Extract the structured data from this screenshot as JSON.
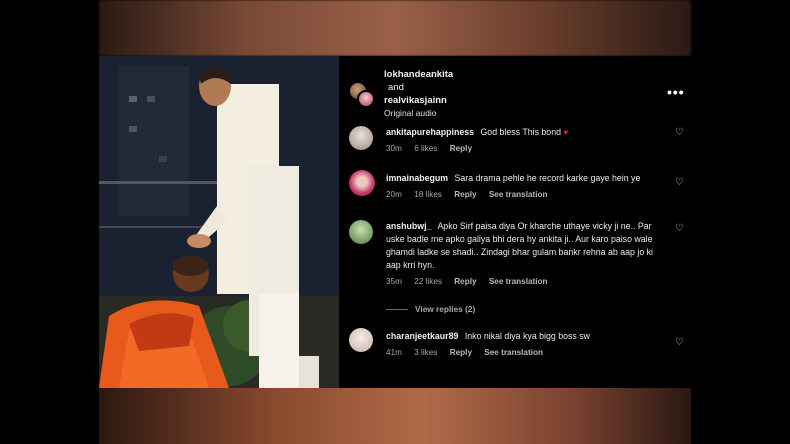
{
  "header": {
    "user1": "lokhandeankita",
    "conjunction": "and",
    "user2": "realvikasjainn",
    "audio": "Original audio",
    "more_icon": "more-horizontal-icon"
  },
  "comments": [
    {
      "username": "ankitapurehappiness",
      "text": "God bless This bond",
      "time": "30m",
      "likes": "6 likes",
      "reply": "Reply",
      "translation": "",
      "avatar_color": "#9a8a80"
    },
    {
      "username": "imnainabegum",
      "text": "Sara drama pehle he record karke gaye hein ye",
      "time": "20m",
      "likes": "18 likes",
      "reply": "Reply",
      "translation": "See translation",
      "avatar_color": "#c03a6a"
    },
    {
      "username": "anshubwj_",
      "text": "Apko Sirf paisa diya Or kharche uthaye vicky ji ne.. Par uske badle me apko galiya bhi dera hy ankita ji.. Aur karo paiso wale ghamdi ladke se shadi.. Zindagi bhar gulam bankr rehna ab aap jo ki aap krri hyn.",
      "time": "35m",
      "likes": "22 likes",
      "reply": "Reply",
      "translation": "See translation",
      "view_replies": "View replies (2)",
      "avatar_color": "#6a8a4a"
    },
    {
      "username": "charanjeetkaur89",
      "text": "Inko nikal diya kya bigg boss sw",
      "time": "41m",
      "likes": "3 likes",
      "reply": "Reply",
      "translation": "See translation",
      "avatar_color": "#d8c8c0"
    }
  ],
  "colors": {
    "panel_bg": "#000000",
    "text": "#eaeaea",
    "meta": "#a8a8a8",
    "heart_red": "#e0243a"
  }
}
